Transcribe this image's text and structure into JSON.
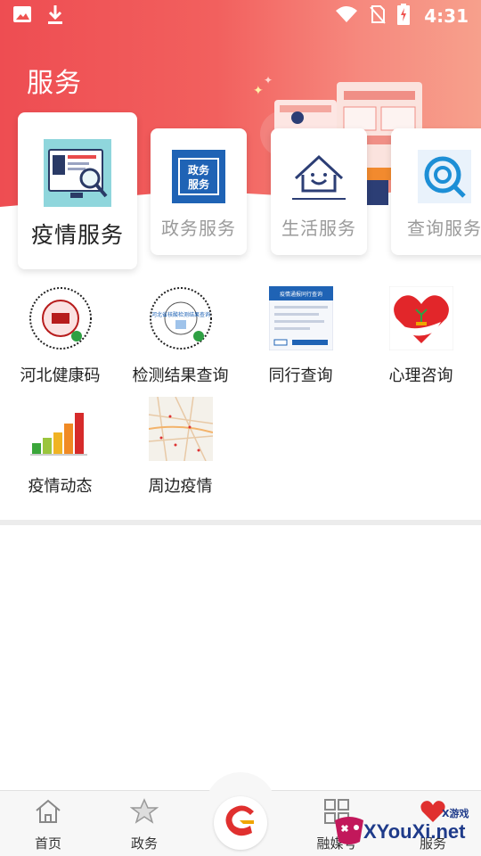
{
  "status_bar": {
    "time": "4:31",
    "icons": [
      "image-icon",
      "download-icon",
      "wifi-icon",
      "no-sim-icon",
      "battery-charging-icon"
    ]
  },
  "page": {
    "title": "服务"
  },
  "service_tabs": [
    {
      "label": "疫情服务",
      "active": true,
      "icon": "monitor-search-icon"
    },
    {
      "label": "政务服务",
      "active": false,
      "icon": "government-badge-icon",
      "badge_text": "政务服务"
    },
    {
      "label": "生活服务",
      "active": false,
      "icon": "smiling-house-icon"
    },
    {
      "label": "查询服务",
      "active": false,
      "icon": "search-c-icon"
    }
  ],
  "grid_items": [
    {
      "label": "河北健康码",
      "icon": "health-qr-code-icon"
    },
    {
      "label": "检测结果查询",
      "icon": "test-result-qr-code-icon",
      "qr_caption": "河北省核酸检测结果查询"
    },
    {
      "label": "同行查询",
      "icon": "travel-query-document-icon",
      "doc_title": "疫情通报同行查询"
    },
    {
      "label": "心理咨询",
      "icon": "heart-hand-icon"
    },
    {
      "label": "疫情动态",
      "icon": "bar-chart-icon"
    },
    {
      "label": "周边疫情",
      "icon": "map-icon"
    }
  ],
  "bottom_nav": [
    {
      "label": "首页",
      "icon": "home-icon"
    },
    {
      "label": "政务",
      "icon": "star-shield-icon"
    },
    {
      "label": "",
      "icon": "center-logo-icon"
    },
    {
      "label": "融媒号",
      "icon": "grid-icon"
    },
    {
      "label": "服务",
      "icon": "heart-service-icon"
    }
  ],
  "watermark": {
    "text": "XYouXi.net",
    "small": "X游戏"
  },
  "colors": {
    "header_start": "#ee4d52",
    "header_end": "#f7a08c",
    "accent": "#e0302f"
  }
}
